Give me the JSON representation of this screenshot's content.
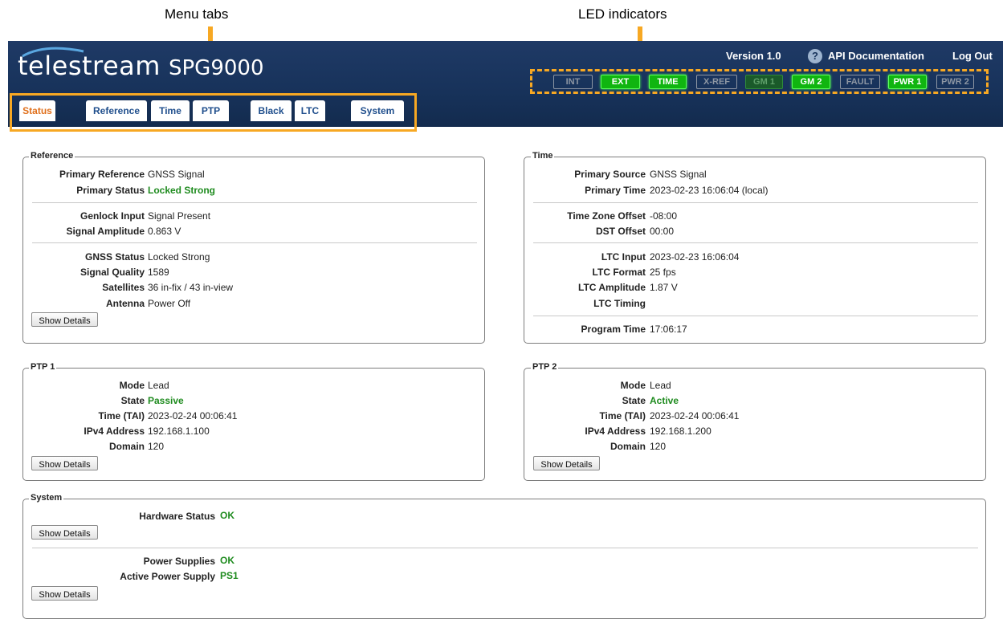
{
  "callouts": {
    "menu_tabs": "Menu tabs",
    "led_indicators": "LED indicators"
  },
  "header": {
    "brand": "telestream",
    "model": "SPG9000",
    "version": "Version 1.0",
    "api_docs": "API Documentation",
    "logout": "Log Out",
    "help_glyph": "?"
  },
  "leds": [
    {
      "label": "INT",
      "state": "off"
    },
    {
      "label": "EXT",
      "state": "on"
    },
    {
      "label": "TIME",
      "state": "on"
    },
    {
      "label": "X-REF",
      "state": "off"
    },
    {
      "label": "GM 1",
      "state": "dim"
    },
    {
      "label": "GM 2",
      "state": "on"
    },
    {
      "label": "FAULT",
      "state": "off"
    },
    {
      "label": "PWR 1",
      "state": "on"
    },
    {
      "label": "PWR 2",
      "state": "off"
    }
  ],
  "tabs": [
    {
      "label": "Status",
      "active": true
    },
    {
      "label": "Reference"
    },
    {
      "label": "Time"
    },
    {
      "label": "PTP"
    },
    {
      "label": "Black"
    },
    {
      "label": "LTC"
    },
    {
      "label": "System"
    }
  ],
  "colors": {
    "accent": "#f7a823",
    "header": "#17325a",
    "ok_green": "#1e8b1e",
    "tab_blue": "#1f4e8c",
    "tab_active": "#e0701c"
  },
  "reference": {
    "title": "Reference",
    "rows": [
      {
        "label": "Primary Reference",
        "value": "GNSS Signal"
      },
      {
        "label": "Primary Status",
        "value": "Locked Strong"
      },
      {
        "label": "Genlock Input",
        "value": "Signal Present"
      },
      {
        "label": "Signal Amplitude",
        "value": "0.863 V"
      },
      {
        "label": "GNSS Status",
        "value": "Locked Strong"
      },
      {
        "label": "Signal Quality",
        "value": "1589"
      },
      {
        "label": "Satellites",
        "value": "36 in-fix / 43 in-view"
      },
      {
        "label": "Antenna",
        "value": "Power Off"
      }
    ],
    "button": "Show Details"
  },
  "time": {
    "title": "Time",
    "rows": [
      {
        "label": "Primary Source",
        "value": "GNSS Signal"
      },
      {
        "label": "Primary Time",
        "value": "2023-02-23 16:06:04 (local)"
      },
      {
        "label": "Time Zone Offset",
        "value": "-08:00"
      },
      {
        "label": "DST Offset",
        "value": "00:00"
      },
      {
        "label": "LTC Input",
        "value": "2023-02-23 16:06:04"
      },
      {
        "label": "LTC Format",
        "value": "25 fps"
      },
      {
        "label": "LTC Amplitude",
        "value": "1.87 V"
      },
      {
        "label": "LTC Timing",
        "value": ""
      },
      {
        "label": "Program Time",
        "value": "17:06:17"
      }
    ]
  },
  "ptp1": {
    "title": "PTP 1",
    "rows": [
      {
        "label": "Mode",
        "value": "Lead"
      },
      {
        "label": "State",
        "value": "Passive"
      },
      {
        "label": "Time (TAI)",
        "value": "2023-02-24 00:06:41"
      },
      {
        "label": "IPv4 Address",
        "value": "192.168.1.100"
      },
      {
        "label": "Domain",
        "value": "120"
      }
    ],
    "button": "Show Details"
  },
  "ptp2": {
    "title": "PTP 2",
    "rows": [
      {
        "label": "Mode",
        "value": "Lead"
      },
      {
        "label": "State",
        "value": "Active"
      },
      {
        "label": "Time (TAI)",
        "value": "2023-02-24 00:06:41"
      },
      {
        "label": "IPv4 Address",
        "value": "192.168.1.200"
      },
      {
        "label": "Domain",
        "value": "120"
      }
    ],
    "button": "Show Details"
  },
  "system": {
    "title": "System",
    "rows": [
      {
        "label": "Hardware Status",
        "value": "OK"
      },
      {
        "label": "Power Supplies",
        "value": "OK"
      },
      {
        "label": "Active Power Supply",
        "value": "PS1"
      }
    ],
    "button1": "Show Details",
    "button2": "Show Details"
  }
}
